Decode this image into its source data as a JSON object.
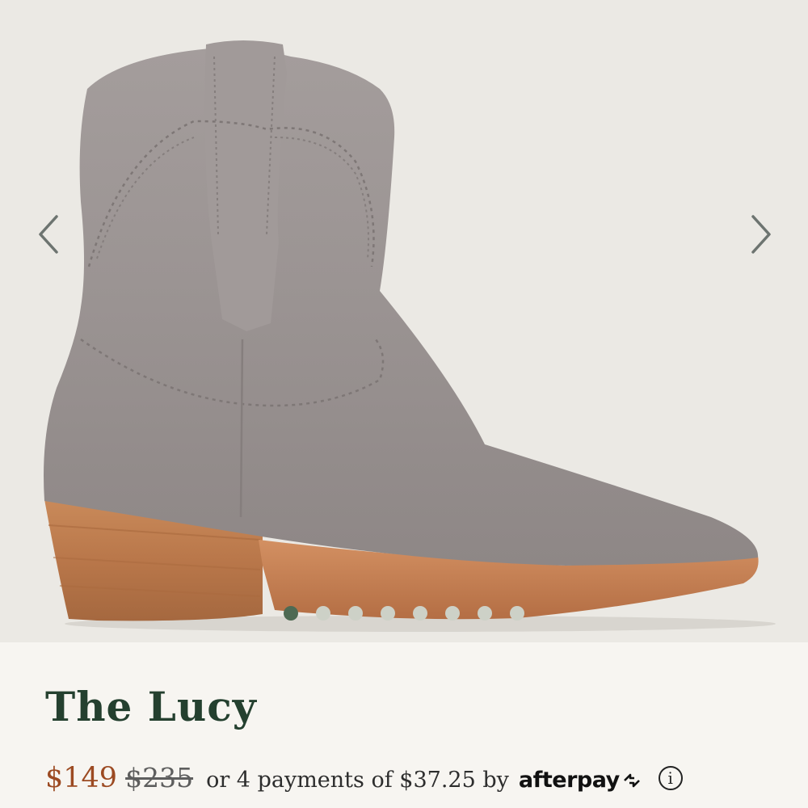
{
  "product": {
    "name": "The Lucy",
    "price": "$149",
    "original_price": "$235",
    "installment_text": "or 4 payments of $37.25 by",
    "payment_provider": "afterpay",
    "info_icon": "info-icon"
  },
  "gallery": {
    "image_alt": "gray suede western ankle boot with stacked wooden heel",
    "slide_count": 8,
    "active_index": 0,
    "prev_icon": "chevron-left-icon",
    "next_icon": "chevron-right-icon"
  },
  "colors": {
    "title": "#24402f",
    "price": "#9c4a22",
    "active_dot": "#4e6a53",
    "inactive_dot": "#cdd1c7",
    "background": "#f7f5f1"
  }
}
